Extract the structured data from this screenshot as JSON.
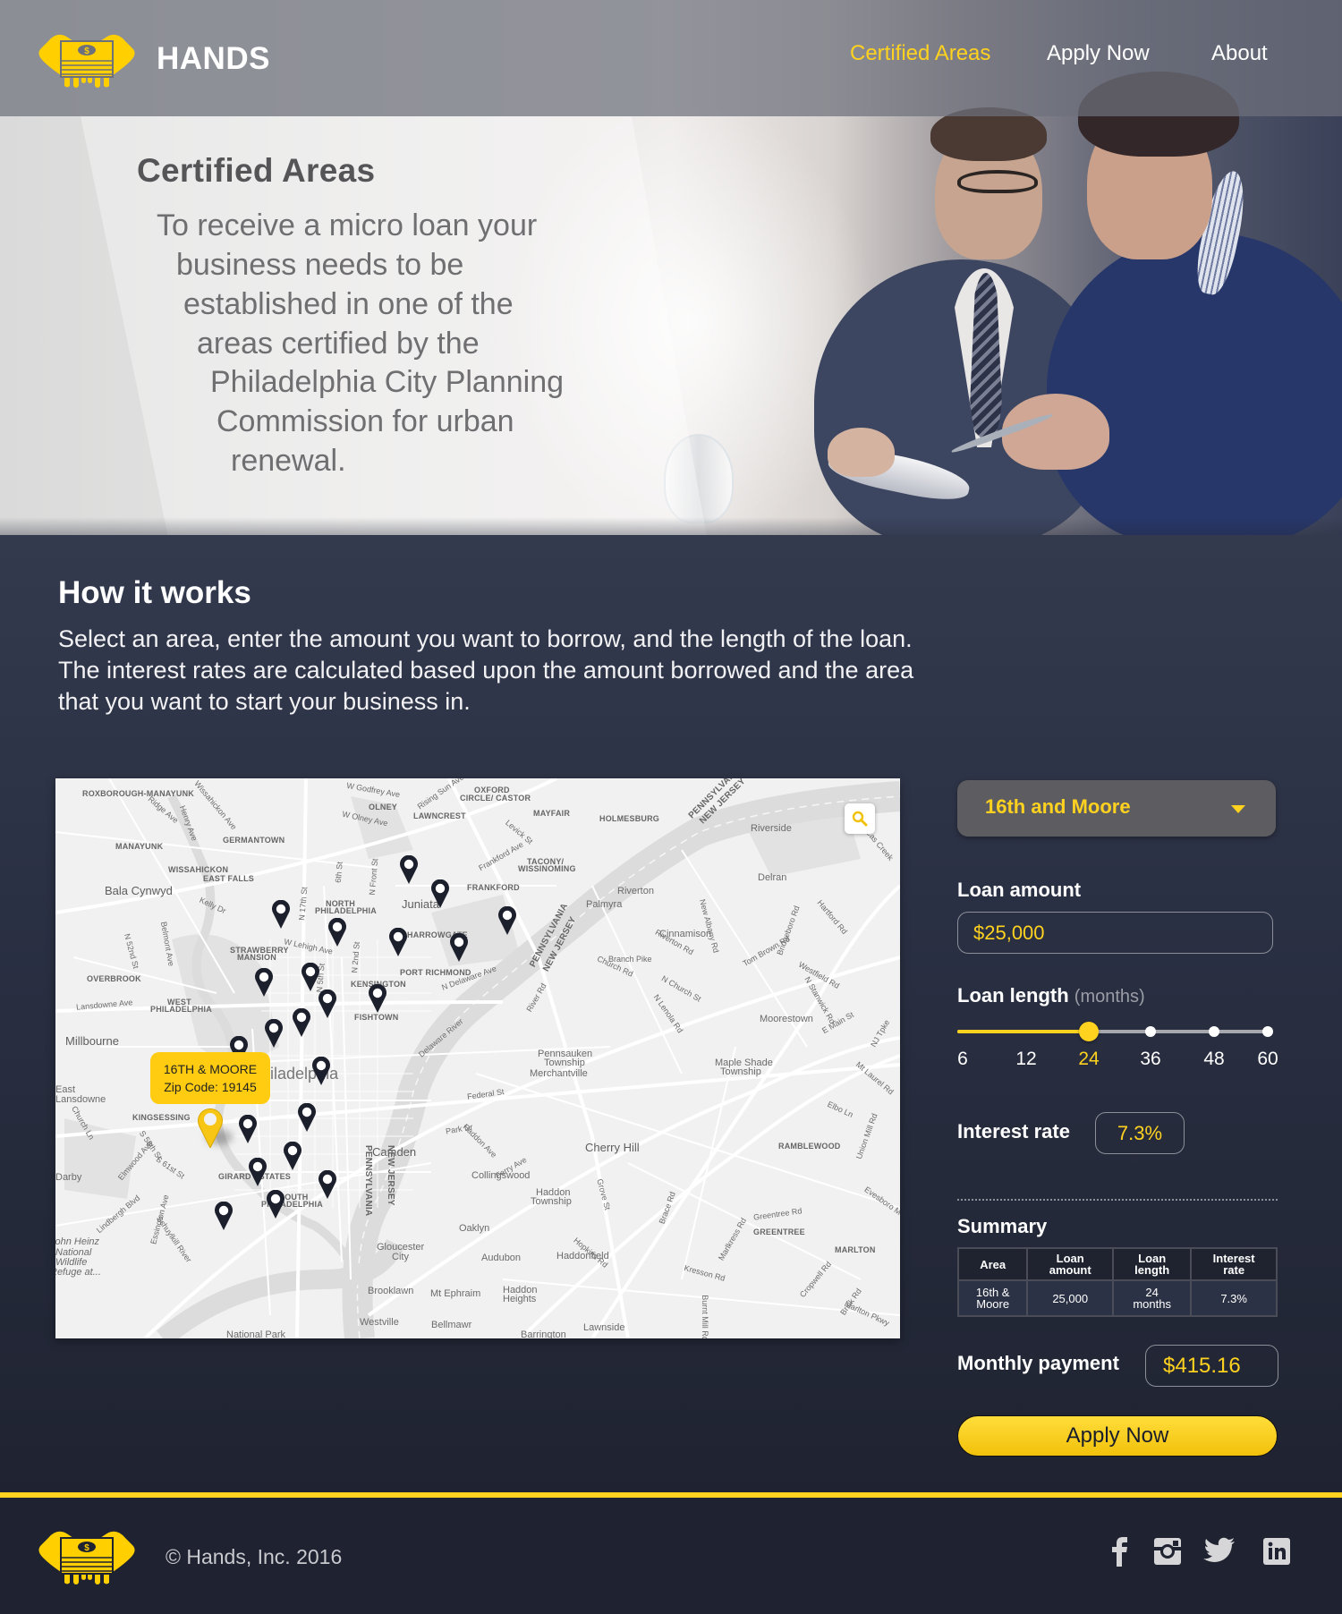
{
  "brand": {
    "name": "HANDS",
    "logo_icon": "hands-holding-money-icon",
    "accent_color": "#ffd21f",
    "dark_bg_color": "#232838"
  },
  "nav": {
    "items": [
      {
        "label": "Certified Areas",
        "active": true
      },
      {
        "label": "Apply Now",
        "active": false
      },
      {
        "label": "About",
        "active": false
      }
    ]
  },
  "hero": {
    "title": "Certified Areas",
    "lines": [
      "To receive a micro loan your",
      "business needs to be",
      "established in one of the",
      "areas certified by the",
      "Philadelphia City Planning",
      "Commission for urban",
      "renewal."
    ]
  },
  "how": {
    "title": "How it works",
    "text": "Select an area, enter the amount you want to borrow, and the length of the loan. The interest rates are calculated based upon the amount borrowed and the area that you want to start your business in."
  },
  "map": {
    "search_icon": "search-icon",
    "selected_pin": {
      "title": "16TH & MOORE",
      "zip_label": "Zip Code: 19145"
    },
    "labels": {
      "caps": [
        "ROXBOROUGH-MANAYUNK",
        "MANAYUNK",
        "GERMANTOWN",
        "WISSAHICKON",
        "EAST FALLS",
        "NORTH",
        "PHILADELPHIA",
        "OLNEY",
        "LAWNCREST",
        "OXFORD",
        "CIRCLE/ CASTOR",
        "MAYFAIR",
        "HOLMESBURG",
        "TACONY/",
        "WISSINOMING",
        "FRANKFORD",
        "HARROWGATE",
        "PORT RICHMOND",
        "KENSINGTON",
        "FISHTOWN",
        "STRAWBERRY",
        "MANSION",
        "OVERBROOK",
        "WEST",
        "PHILADELPHIA ",
        "KINGSESSING",
        "GIRARD ESTATES",
        "SOUTH",
        "PHILADELPHIA  ",
        "RAMBLEWOOD",
        "GREENTREE",
        "MARLTON"
      ],
      "cities": [
        "Bala Cynwyd",
        "Juniata",
        "Millbourne",
        "East",
        "Lansdowne",
        "Darby",
        "Philadelphia",
        "Camden",
        "Riverside",
        "Delran",
        "Riverton",
        "Palmyra",
        "Cinnamison",
        "Moorestown",
        "Pennsauken",
        "Township",
        "Merchantville",
        "Maple Shade",
        "Township ",
        "Cherry Hill",
        "Collingswood",
        "Haddon",
        "Township  ",
        "Oaklyn",
        "Gloucester",
        "City",
        "Audubon",
        "Haddonfield",
        "Brooklawn",
        "Mt Ephraim",
        "Haddon ",
        "Heights",
        "Westville",
        "Bellmawr",
        "Lawnside",
        "Barrington",
        "National Park",
        "John Heinz",
        "National",
        "Wildlife",
        "Refuge at..."
      ],
      "roads": [
        "Ridge Ave",
        "Henry Ave",
        "Wissahickon Ave",
        "Kelly Dr",
        "Belmont Ave",
        "N 52nd St",
        "Lansdowne Ave",
        "W Lehigh Ave",
        "N 17th St",
        "N 5th St",
        "N 2nd St",
        "N Front St",
        "6th St",
        "W Godfrey Ave",
        "W Olney Ave",
        "Rising Sun Ave",
        "Levick St",
        "Frankford Ave",
        "N Delaware Ave",
        "Delaware River",
        "River Rd",
        "Church Rd",
        "Branch Pike",
        "Riverton Rd",
        "N Church St",
        "N Lenola Rd",
        "New Albany Rd",
        "Tom Brown Rd",
        "Bridgeboro Rd",
        "Hartford Rd",
        "Westfield Rd",
        "N Stanwick Rd",
        "E Main St",
        "NJ Tpke",
        "Rancocas Creek",
        "Federal St",
        "Haddon Ave",
        "Ferry Ave",
        "Grove St",
        "Brace Rd",
        "Hopkins Rd",
        "Kresson Rd",
        "Marlkress Rd",
        "Greentree Rd",
        "Cropwell Rd",
        "Brick Rd",
        "Marlton Pkwy",
        "Evesboro Med",
        "Union Mill Rd",
        "Elbo Ln",
        "Mt Laurel Rd",
        "S 58th St",
        "S 61st St",
        "Elmwood Ave",
        "Lindbergh Blvd",
        "Essington Ave",
        "Schuylkill River",
        "Church Ln",
        "Park Dr",
        "Burnt Mill Rd"
      ],
      "borders": [
        "PENNSYLVANIA",
        "NEW JERSEY"
      ]
    }
  },
  "calculator": {
    "area_select": {
      "selected": "16th and Moore"
    },
    "loan_amount": {
      "label": "Loan amount",
      "value": "$25,000"
    },
    "loan_length": {
      "label": "Loan length",
      "unit": "(months)",
      "options": [
        "6",
        "12",
        "24",
        "36",
        "48",
        "60"
      ],
      "selected": "24"
    },
    "interest": {
      "label": "Interest rate",
      "value": "7.3%"
    },
    "summary": {
      "title": "Summary",
      "headers": [
        [
          "Area"
        ],
        [
          "Loan",
          "amount"
        ],
        [
          "Loan",
          "length"
        ],
        [
          "Interest",
          "rate"
        ]
      ],
      "rows": [
        [
          [
            "16th &",
            "Moore"
          ],
          [
            "25,000"
          ],
          [
            "24",
            "months"
          ],
          [
            "7.3%"
          ]
        ]
      ]
    },
    "monthly": {
      "label": "Monthly payment",
      "value": "$415.16"
    },
    "apply_label": "Apply Now"
  },
  "footer": {
    "copyright": "© Hands, Inc.  2016",
    "social": [
      {
        "name": "facebook-icon"
      },
      {
        "name": "instagram-icon"
      },
      {
        "name": "twitter-icon"
      },
      {
        "name": "linkedin-icon"
      }
    ]
  }
}
